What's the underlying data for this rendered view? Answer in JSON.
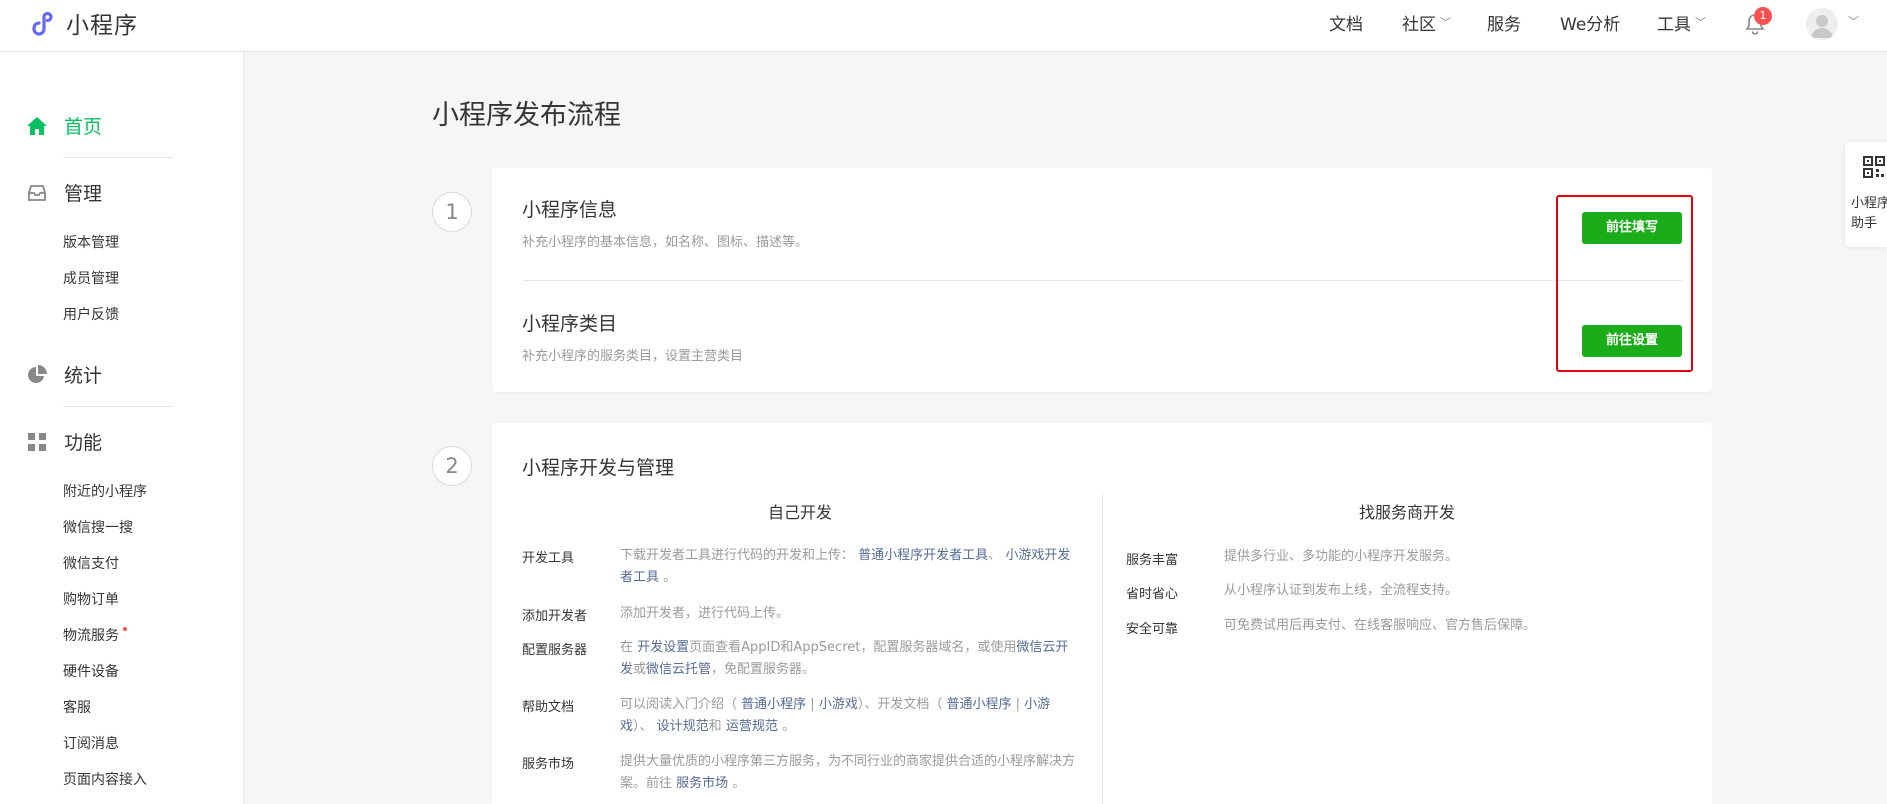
{
  "header": {
    "logo_text": "小程序",
    "nav": [
      {
        "label": "文档",
        "dropdown": false
      },
      {
        "label": "社区",
        "dropdown": true
      },
      {
        "label": "服务",
        "dropdown": false
      },
      {
        "label": "We分析",
        "dropdown": false
      },
      {
        "label": "工具",
        "dropdown": true
      }
    ],
    "notification_count": "1"
  },
  "sidebar": {
    "home": "首页",
    "manage": "管理",
    "manage_items": [
      "版本管理",
      "成员管理",
      "用户反馈"
    ],
    "stats": "统计",
    "features": "功能",
    "feature_items": [
      "附近的小程序",
      "微信搜一搜",
      "微信支付",
      "购物订单",
      "物流服务",
      "硬件设备",
      "客服",
      "订阅消息",
      "页面内容接入"
    ]
  },
  "page": {
    "title": "小程序发布流程",
    "step1": {
      "number": "1",
      "info_title": "小程序信息",
      "info_desc": "补充小程序的基本信息，如名称、图标、描述等。",
      "info_button": "前往填写",
      "category_title": "小程序类目",
      "category_desc": "补充小程序的服务类目，设置主营类目",
      "category_button": "前往设置"
    },
    "step2": {
      "number": "2",
      "title": "小程序开发与管理",
      "self_dev": {
        "heading": "自己开发",
        "rows": [
          {
            "label": "开发工具",
            "text": "下载开发者工具进行代码的开发和上传：",
            "link1": "普通小程序开发者工具",
            "sep": "、",
            "link2": "小游戏开发者工具",
            "end": " 。"
          },
          {
            "label": "添加开发者",
            "text": "添加开发者，进行代码上传。"
          },
          {
            "label": "配置服务器",
            "pre": "在 ",
            "link1": "开发设置",
            "mid": "页面查看AppID和AppSecret，配置服务器域名，或使用",
            "link2": "微信云开发",
            "mid2": "或",
            "link3": "微信云托管",
            "end": "，免配置服务器。"
          },
          {
            "label": "帮助文档",
            "pre": "可以阅读入门介绍（ ",
            "link1": "普通小程序",
            "bar": " | ",
            "link2": "小游戏",
            "mid": "）、开发文档（ ",
            "link3": "普通小程序",
            "link4": "小游戏",
            "mid2": "）、 ",
            "link5": "设计规范",
            "and": "和 ",
            "link6": "运营规范",
            "end": " 。"
          },
          {
            "label": "服务市场",
            "pre": "提供大量优质的小程序第三方服务，为不同行业的商家提供合适的小程序解决方案。前往 ",
            "link1": "服务市场",
            "end": " 。"
          }
        ]
      },
      "provider_dev": {
        "heading": "找服务商开发",
        "rows": [
          {
            "label": "服务丰富",
            "text": "提供多行业、多功能的小程序开发服务。"
          },
          {
            "label": "省时省心",
            "text": "从小程序认证到发布上线，全流程支持。"
          },
          {
            "label": "安全可靠",
            "text": "可免费试用后再支付、在线客服响应、官方售后保障。"
          }
        ]
      }
    }
  },
  "float_helper": {
    "line1": "小程序",
    "line2": "助手"
  },
  "colors": {
    "accent_green": "#07c160",
    "button_green": "#1aad19",
    "highlight_red": "#e60012",
    "link_blue": "#576b95"
  }
}
